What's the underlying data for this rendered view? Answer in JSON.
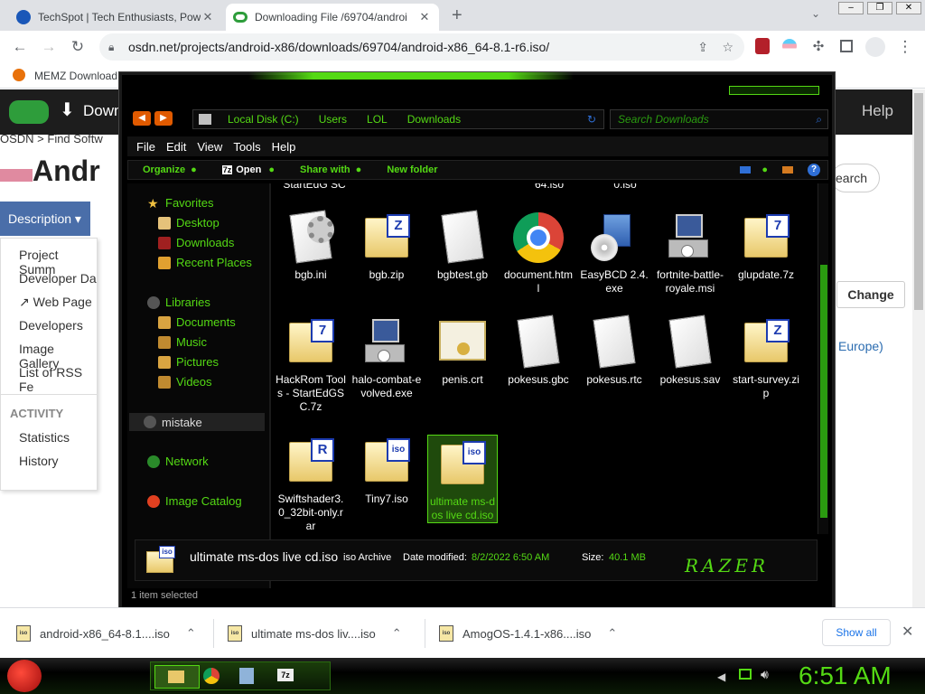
{
  "browser": {
    "tabs": [
      {
        "title": "TechSpot | Tech Enthusiasts, Pow",
        "close": "✕"
      },
      {
        "title": "Downloading File /69704/androi",
        "close": "✕"
      }
    ],
    "new_tab": "+",
    "url": "osdn.net/projects/android-x86/downloads/69704/android-x86_64-8.1-r6.iso/",
    "bookmarks": [
      "MEMZ Download"
    ]
  },
  "osdn": {
    "download_label": "Down",
    "help": "Help",
    "breadcrumb": "OSDN > Find Softw",
    "heading": "Andr",
    "description_btn": "Description ▾",
    "search_btn": "earch",
    "menu": [
      "Project Summ",
      "Developer Da",
      "Web Page",
      "Developers",
      "Image Gallery",
      "List of RSS Fe"
    ],
    "activity_title": "ACTIVITY",
    "activity": [
      "Statistics",
      "History"
    ],
    "change_btn": "Change",
    "region": "Europe)"
  },
  "explorer": {
    "path": [
      "Local Disk (C:)",
      "Users",
      "LOL",
      "Downloads"
    ],
    "search_placeholder": "Search Downloads",
    "menubar": [
      "File",
      "Edit",
      "View",
      "Tools",
      "Help"
    ],
    "commands": [
      "Organize",
      "Open",
      "Share with",
      "New folder"
    ],
    "nav": {
      "favorites": "Favorites",
      "fav_items": [
        "Desktop",
        "Downloads",
        "Recent Places"
      ],
      "libraries": "Libraries",
      "lib_items": [
        "Documents",
        "Music",
        "Pictures",
        "Videos"
      ],
      "mistake": "mistake",
      "network": "Network",
      "catalog": "Image Catalog"
    },
    "top_partial": [
      "StartEdG SC",
      "64.iso",
      "0.iso"
    ],
    "files": [
      {
        "name": "bgb.ini",
        "icon": "settings-file-icon"
      },
      {
        "name": "bgb.zip",
        "icon": "zip-archive-icon",
        "badge": "Z"
      },
      {
        "name": "bgbtest.gb",
        "icon": "blank-file-icon"
      },
      {
        "name": "document.html",
        "icon": "chrome-html-icon"
      },
      {
        "name": "EasyBCD 2.4.exe",
        "icon": "easybcd-icon"
      },
      {
        "name": "fortnite-battle-royale.msi",
        "icon": "msi-installer-icon"
      },
      {
        "name": "glupdate.7z",
        "icon": "7z-archive-icon",
        "badge": "7"
      },
      {
        "name": "HackRom Tools - StartEdGSC.7z",
        "icon": "7z-archive-icon",
        "badge": "7"
      },
      {
        "name": "halo-combat-evolved.exe",
        "icon": "setup-exe-icon"
      },
      {
        "name": "penis.crt",
        "icon": "certificate-icon"
      },
      {
        "name": "pokesus.gbc",
        "icon": "blank-file-icon"
      },
      {
        "name": "pokesus.rtc",
        "icon": "blank-file-icon"
      },
      {
        "name": "pokesus.sav",
        "icon": "blank-file-icon"
      },
      {
        "name": "start-survey.zip",
        "icon": "zip-archive-icon",
        "badge": "Z"
      },
      {
        "name": "Swiftshader3.0_32bit-only.rar",
        "icon": "rar-archive-icon",
        "badge": "R"
      },
      {
        "name": "Tiny7.iso",
        "icon": "iso-archive-icon",
        "badge": "iso"
      },
      {
        "name": "ultimate ms-dos live cd.iso",
        "icon": "iso-archive-icon",
        "badge": "iso",
        "selected": true
      }
    ],
    "details": {
      "name": "ultimate ms-dos live cd.iso",
      "type": "iso Archive",
      "date_label": "Date modified:",
      "date": "8/2/2022 6:50 AM",
      "size_label": "Size:",
      "size": "40.1 MB",
      "brand": "RAZER"
    },
    "status": "1 item selected"
  },
  "downloads": [
    {
      "name": "android-x86_64-8.1....iso"
    },
    {
      "name": "ultimate ms-dos liv....iso"
    },
    {
      "name": "AmogOS-1.4.1-x86....iso"
    }
  ],
  "show_all": "Show all",
  "taskbar": {
    "clock": "6:51 AM"
  },
  "colors": {
    "accent_green": "#54d914",
    "dark": "#000000",
    "chrome_gray": "#dfe1e5"
  }
}
